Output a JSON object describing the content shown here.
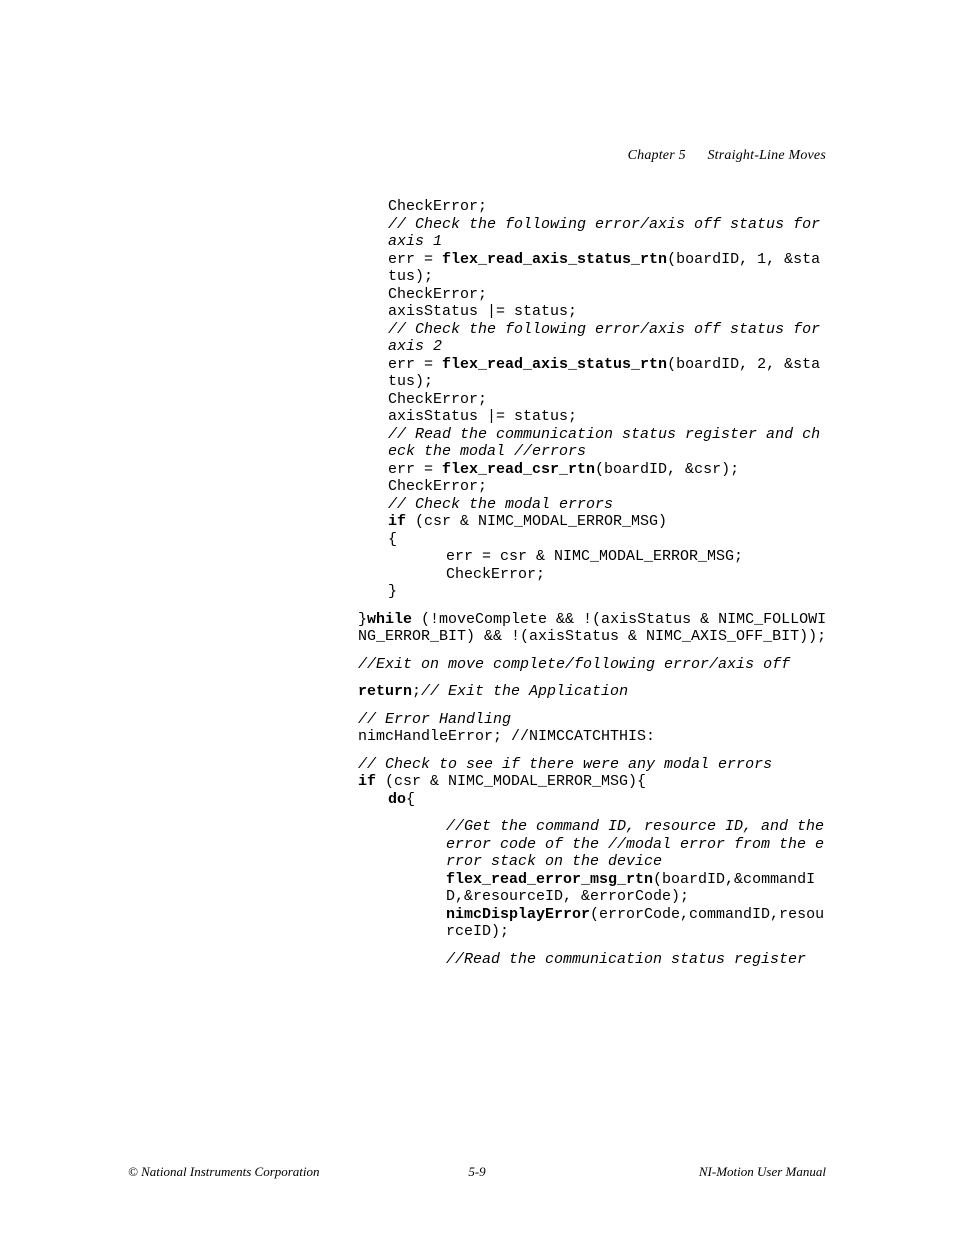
{
  "header": {
    "chapter": "Chapter 5",
    "title": "Straight-Line Moves"
  },
  "code": {
    "lines": [
      {
        "ind": 1,
        "segs": [
          {
            "t": "CheckError;"
          }
        ]
      },
      {
        "ind": 1,
        "segs": [
          {
            "t": "// Check the following error/axis off status for axis 1",
            "c": "cm"
          }
        ]
      },
      {
        "ind": 1,
        "segs": [
          {
            "t": "err = "
          },
          {
            "t": "flex_read_axis_status_rtn",
            "c": "fn"
          },
          {
            "t": "(boardID, 1, &status);"
          }
        ]
      },
      {
        "ind": 1,
        "segs": [
          {
            "t": "CheckError;"
          }
        ]
      },
      {
        "ind": 1,
        "segs": [
          {
            "t": "axisStatus |= status;"
          }
        ]
      },
      {
        "ind": 1,
        "segs": [
          {
            "t": "// Check the following error/axis off status for axis 2",
            "c": "cm"
          }
        ]
      },
      {
        "ind": 1,
        "segs": [
          {
            "t": "err = "
          },
          {
            "t": "flex_read_axis_status_rtn",
            "c": "fn"
          },
          {
            "t": "(boardID, 2, &status);"
          }
        ]
      },
      {
        "ind": 1,
        "segs": [
          {
            "t": "CheckError;"
          }
        ]
      },
      {
        "ind": 1,
        "segs": [
          {
            "t": "axisStatus |= status;"
          }
        ]
      },
      {
        "ind": 1,
        "segs": [
          {
            "t": "// Read the communication status register and check the modal //errors",
            "c": "cm"
          }
        ]
      },
      {
        "ind": 1,
        "segs": [
          {
            "t": "err = "
          },
          {
            "t": "flex_read_csr_rtn",
            "c": "fn"
          },
          {
            "t": "(boardID, &csr);"
          }
        ]
      },
      {
        "ind": 1,
        "segs": [
          {
            "t": "CheckError;"
          }
        ]
      },
      {
        "ind": 1,
        "segs": [
          {
            "t": "// Check the modal errors",
            "c": "cm"
          }
        ]
      },
      {
        "ind": 1,
        "segs": [
          {
            "t": "if",
            "c": "kw"
          },
          {
            "t": " (csr & NIMC_MODAL_ERROR_MSG)"
          }
        ]
      },
      {
        "ind": 1,
        "segs": [
          {
            "t": "{"
          }
        ]
      },
      {
        "ind": 2,
        "segs": [
          {
            "t": "err = csr & NIMC_MODAL_ERROR_MSG;"
          }
        ]
      },
      {
        "ind": 2,
        "segs": [
          {
            "t": "CheckError;"
          }
        ]
      },
      {
        "ind": 1,
        "segs": [
          {
            "t": "}"
          }
        ]
      },
      {
        "ind": 0,
        "blk": true,
        "segs": [
          {
            "t": "}"
          },
          {
            "t": "while",
            "c": "kw"
          },
          {
            "t": " (!moveComplete && !(axisStatus & NIMC_FOLLOWING_ERROR_BIT) && !(axisStatus & NIMC_AXIS_OFF_BIT));"
          }
        ]
      },
      {
        "ind": 0,
        "blk": true,
        "segs": [
          {
            "t": "//Exit on move complete/following error/axis off",
            "c": "cm"
          }
        ]
      },
      {
        "ind": 0,
        "blk": true,
        "segs": [
          {
            "t": "return",
            "c": "kw"
          },
          {
            "t": ";"
          },
          {
            "t": "// Exit the Application",
            "c": "cm"
          }
        ]
      },
      {
        "ind": 0,
        "blk": true,
        "segs": [
          {
            "t": "// Error Handling",
            "c": "cm"
          }
        ]
      },
      {
        "ind": 0,
        "segs": [
          {
            "t": "nimcHandleError; //NIMCCATCHTHIS:"
          }
        ]
      },
      {
        "ind": 0,
        "blk": true,
        "segs": [
          {
            "t": "// Check to see if there were any modal errors",
            "c": "cm"
          }
        ]
      },
      {
        "ind": 0,
        "segs": [
          {
            "t": "if",
            "c": "kw"
          },
          {
            "t": " (csr & NIMC_MODAL_ERROR_MSG){"
          }
        ]
      },
      {
        "ind": 1,
        "segs": [
          {
            "t": "do",
            "c": "kw"
          },
          {
            "t": "{"
          }
        ]
      },
      {
        "ind": 2,
        "blk": true,
        "segs": [
          {
            "t": "//Get the command ID, resource ID, and the error code of the //modal error from the error stack on the device",
            "c": "cm"
          }
        ]
      },
      {
        "ind": 2,
        "segs": [
          {
            "t": "flex_read_error_msg_rtn",
            "c": "fn"
          },
          {
            "t": "(boardID,&commandID,&resourceID, &errorCode);"
          }
        ]
      },
      {
        "ind": 2,
        "segs": [
          {
            "t": "nimcDisplayError",
            "c": "fn"
          },
          {
            "t": "(errorCode,commandID,resourceID);"
          }
        ]
      },
      {
        "ind": 2,
        "blk": true,
        "segs": [
          {
            "t": "//Read the communication status register",
            "c": "cm"
          }
        ]
      }
    ]
  },
  "footer": {
    "left": "© National Instruments Corporation",
    "center": "5-9",
    "right": "NI-Motion User Manual"
  }
}
